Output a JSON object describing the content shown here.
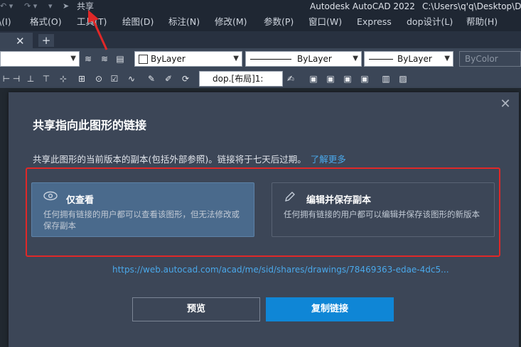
{
  "titlebar": {
    "share_label": "共享",
    "app_title": "Autodesk AutoCAD 2022",
    "path": "C:\\Users\\q'q\\Desktop\\D"
  },
  "menu": [
    {
      "label": "\\(I)"
    },
    {
      "label": "格式(O)"
    },
    {
      "label": "工具(T)"
    },
    {
      "label": "绘图(D)"
    },
    {
      "label": "标注(N)"
    },
    {
      "label": "修改(M)"
    },
    {
      "label": "参数(P)"
    },
    {
      "label": "窗口(W)"
    },
    {
      "label": "Express"
    },
    {
      "label": "dop设计(L)"
    },
    {
      "label": "帮助(H)"
    }
  ],
  "tabs": {
    "close": "✕",
    "add": "+"
  },
  "toolbar": {
    "layer_combo": "ByLayer",
    "linetype_combo": "ByLayer",
    "lineweight_combo": "ByLayer",
    "color_combo": "ByColor",
    "dim_style": "dop.[布局]1:"
  },
  "dialog": {
    "title": "共享指向此图形的链接",
    "description": "共享此图形的当前版本的副本(包括外部参照)。链接将于七天后过期。",
    "learn_more": "了解更多",
    "close": "✕",
    "options": [
      {
        "icon": "eye-icon",
        "title": "仅查看",
        "description": "任何拥有链接的用户都可以查看该图形，但无法修改或保存副本",
        "selected": true
      },
      {
        "icon": "pencil-icon",
        "title": "编辑并保存副本",
        "description": "任何拥有链接的用户都可以编辑并保存该图形的新版本",
        "selected": false
      }
    ],
    "url": "https://web.autocad.com/acad/me/sid/shares/drawings/78469363-edae-4dc5...",
    "preview_button": "预览",
    "copy_button": "复制链接"
  },
  "colors": {
    "accent": "#0f86d6",
    "link": "#4aa8ea",
    "annotation": "#e02828"
  }
}
